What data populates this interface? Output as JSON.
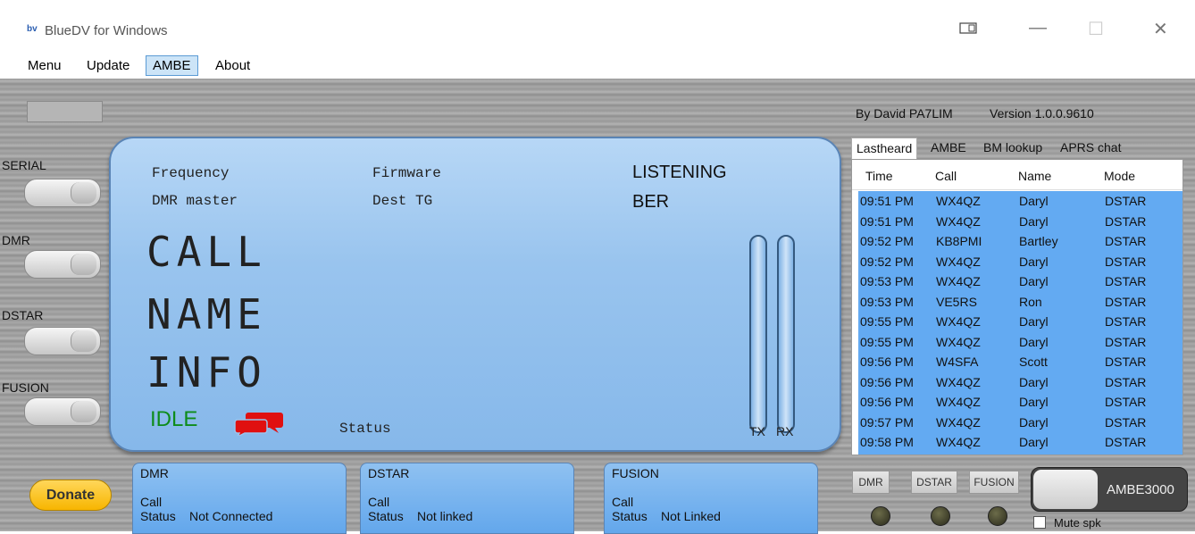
{
  "window": {
    "icon_text": "bv",
    "title": "BlueDV for Windows",
    "minimize_glyph": "—",
    "maximize_glyph": "☐",
    "close_glyph": "✕"
  },
  "menu": [
    "Menu",
    "Update",
    "AMBE",
    "About"
  ],
  "left_panel": {
    "serial_label": "SERIAL",
    "dmr_label": "DMR",
    "dstar_label": "DSTAR",
    "fusion_label": "FUSION",
    "donate_label": "Donate"
  },
  "display": {
    "frequency_label": "Frequency",
    "firmware_label": "Firmware",
    "listening_label": "LISTENING",
    "dmr_master_label": "DMR master",
    "dest_tg_label": "Dest TG",
    "ber_label": "BER",
    "call": "CALL",
    "name": "NAME",
    "info": "INFO",
    "idle": "IDLE",
    "status": "Status",
    "tx_label": "TX",
    "rx_label": "RX"
  },
  "right_panel": {
    "author": "By David PA7LIM",
    "version": "Version 1.0.0.9610",
    "tabs": [
      "Lastheard",
      "AMBE",
      "BM lookup",
      "APRS chat"
    ],
    "columns": [
      "Time",
      "Call",
      "Name",
      "Mode"
    ],
    "rows": [
      [
        "09:51 PM",
        "WX4QZ",
        "Daryl",
        "DSTAR"
      ],
      [
        "09:51 PM",
        "WX4QZ",
        "Daryl",
        "DSTAR"
      ],
      [
        "09:52 PM",
        "KB8PMI",
        "Bartley",
        "DSTAR"
      ],
      [
        "09:52 PM",
        "WX4QZ",
        "Daryl",
        "DSTAR"
      ],
      [
        "09:53 PM",
        "WX4QZ",
        "Daryl",
        "DSTAR"
      ],
      [
        "09:53 PM",
        "VE5RS",
        "Ron",
        "DSTAR"
      ],
      [
        "09:55 PM",
        "WX4QZ",
        "Daryl",
        "DSTAR"
      ],
      [
        "09:55 PM",
        "WX4QZ",
        "Daryl",
        "DSTAR"
      ],
      [
        "09:56 PM",
        "W4SFA",
        "Scott",
        "DSTAR"
      ],
      [
        "09:56 PM",
        "WX4QZ",
        "Daryl",
        "DSTAR"
      ],
      [
        "09:56 PM",
        "WX4QZ",
        "Daryl",
        "DSTAR"
      ],
      [
        "09:57 PM",
        "WX4QZ",
        "Daryl",
        "DSTAR"
      ],
      [
        "09:58 PM",
        "WX4QZ",
        "Daryl",
        "DSTAR"
      ]
    ],
    "mode_buttons": [
      "DMR",
      "DSTAR",
      "FUSION"
    ],
    "ambe_button": "AMBE3000",
    "mute_label": "Mute spk"
  },
  "bottom_panels": [
    {
      "title": "DMR",
      "call_label": "Call",
      "status_label": "Status",
      "status_value": "Not Connected"
    },
    {
      "title": "DSTAR",
      "call_label": "Call",
      "status_label": "Status",
      "status_value": "Not linked"
    },
    {
      "title": "FUSION",
      "call_label": "Call",
      "status_label": "Status",
      "status_value": "Not Linked"
    }
  ],
  "colors": {
    "lcd_blue": "#99c4ee",
    "idle_green": "#0e8c1a",
    "grid_selection": "#63aaf2",
    "chat_icon_red": "#e01010",
    "donate_yellow": "#f7b500"
  }
}
